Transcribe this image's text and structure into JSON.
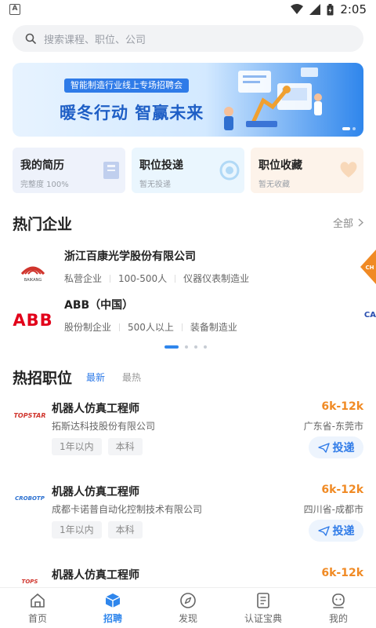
{
  "status_bar": {
    "time": "2:05",
    "notification_icon": "A"
  },
  "search": {
    "placeholder": "搜索课程、职位、公司"
  },
  "banner": {
    "subtitle": "智能制造行业线上专场招聘会",
    "title": "暖冬行动 智赢未来"
  },
  "quick_cards": [
    {
      "title": "我的简历",
      "sub": "完整度 100%"
    },
    {
      "title": "职位投递",
      "sub": "暂无投递"
    },
    {
      "title": "职位收藏",
      "sub": "暂无收藏"
    }
  ],
  "hot_companies": {
    "title": "热门企业",
    "see_all": "全部",
    "items": [
      {
        "name": "浙江百康光学股份有限公司",
        "type": "私营企业",
        "size": "100-500人",
        "industry": "仪器仪表制造业",
        "logo_text": "BAIKANG"
      },
      {
        "name": "ABB（中国）",
        "type": "股份制企业",
        "size": "500人以上",
        "industry": "装备制造业",
        "logo_text": "ABB"
      }
    ],
    "peek_text": "CH",
    "peek_text2": "CA"
  },
  "hot_jobs": {
    "title": "热招职位",
    "tab_latest": "最新",
    "tab_hottest": "最热",
    "apply_label": "投递",
    "items": [
      {
        "title": "机器人仿真工程师",
        "company": "拓斯达科技股份有限公司",
        "salary": "6k-12k",
        "location": "广东省-东莞市",
        "exp": "1年以内",
        "edu": "本科",
        "logo_text": "TOPSTAR"
      },
      {
        "title": "机器人仿真工程师",
        "company": "成都卡诺普自动化控制技术有限公司",
        "salary": "6k-12k",
        "location": "四川省-成都市",
        "exp": "1年以内",
        "edu": "本科",
        "logo_text": "CROBOTP"
      },
      {
        "title": "机器人仿真工程师",
        "salary": "6k-12k",
        "logo_text": "TOPS"
      }
    ]
  },
  "bottom_nav": [
    {
      "label": "首页",
      "icon": "home-icon"
    },
    {
      "label": "招聘",
      "icon": "cube-icon"
    },
    {
      "label": "发现",
      "icon": "compass-icon"
    },
    {
      "label": "认证宝典",
      "icon": "document-icon"
    },
    {
      "label": "我的",
      "icon": "profile-icon"
    }
  ],
  "colors": {
    "accent": "#2f86ec",
    "salary": "#f08a24"
  }
}
